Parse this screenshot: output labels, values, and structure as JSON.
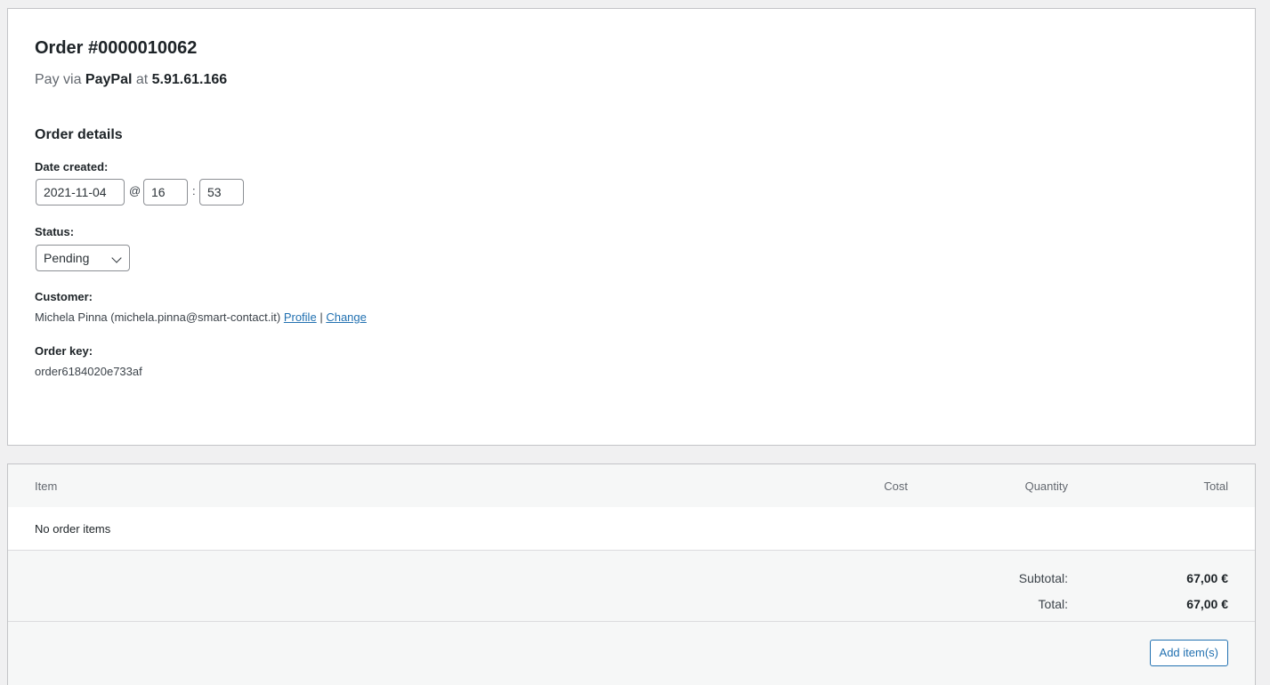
{
  "order": {
    "title": "Order #0000010062",
    "pay_prefix": "Pay via",
    "pay_method": "PayPal",
    "pay_at": "at",
    "ip": "5.91.61.166"
  },
  "details": {
    "section_title": "Order details",
    "date_label": "Date created:",
    "date_value": "2021-11-04",
    "at_sep": "@",
    "hour": "16",
    "colon_sep": ":",
    "minute": "53",
    "status_label": "Status:",
    "status_value": "Pending",
    "customer_label": "Customer:",
    "customer_text": "Michela Pinna (michela.pinna@smart-contact.it)",
    "profile_link": "Profile",
    "link_sep": "|",
    "change_link": "Change",
    "order_key_label": "Order key:",
    "order_key_value": "order6184020e733af"
  },
  "items": {
    "columns": [
      "Item",
      "Cost",
      "Quantity",
      "Total"
    ],
    "empty_text": "No order items",
    "subtotal_label": "Subtotal:",
    "subtotal_value": "67,00 €",
    "total_label": "Total:",
    "total_value": "67,00 €",
    "add_button": "Add item(s)"
  },
  "colors": {
    "link": "#2271b1",
    "border": "#c3c4c7",
    "panel_bg": "#ffffff",
    "page_bg": "#f0f0f1"
  }
}
